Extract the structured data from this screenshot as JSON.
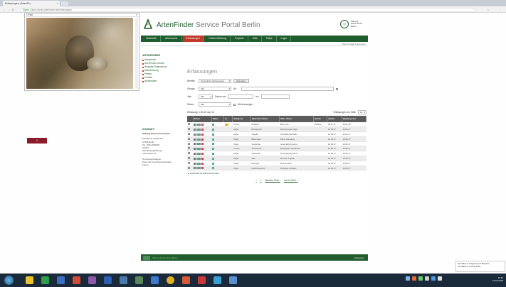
{
  "browser": {
    "tab_title": "Erfassungen | ArtenFin...",
    "tab_close": "×",
    "url_scheme": "https://",
    "url_path": "berlin.artenfinder.net/erfassungen",
    "url_prefix": "Sicher",
    "back": "←",
    "forward": "→",
    "reload": "C",
    "home": "⌂",
    "star": "☆",
    "menu": "⋮"
  },
  "popup": {
    "title": "1 Foto",
    "close": "×"
  },
  "red_button": "1",
  "site": {
    "logo_main": "ArtenFinder",
    "logo_rest": " Service Portal Berlin",
    "stiftung": "Stiftung\nNaturschutz\nBerlin",
    "nav": [
      "Startseite",
      "Artensuche",
      "Erfassungen",
      "Online-Meldung",
      "Projekte",
      "Hilfe",
      "FAQs",
      "Login"
    ],
    "nav_active_index": 2,
    "subnav": "Über Kontakt   Impressum"
  },
  "sidebar": {
    "heading": "ARTENFINDER",
    "links": [
      "Artensuche",
      "ArtenFinder werden",
      "Hinweise Datenschutz",
      "Datennutzung",
      "Presse",
      "Kontakt",
      "Nutzerdaten"
    ],
    "kontakt_heading": "KONTAKT",
    "kontakt_org": "Stiftung Naturschutz Berlin",
    "kontakt_address": "Potsdamer Straße 68\n10785 Berlin\nTel.: 030-2639400\nE-Mail:\nartenfinder@stiftung-\nnaturschutz.de",
    "kontakt_partner": "Ihr Ansprechpartner:\nTeam der Koordinierungsstelle\nFauna"
  },
  "content": {
    "heading": "Erfassungen",
    "filters": {
      "bereich_label": "Bereich",
      "bereich_value": "Persönliche Erfassungen",
      "absenden": "Absenden",
      "gruppe_label": "Gruppe",
      "gruppe_value": "Alle",
      "art_label": "Art",
      "jahr_label": "Jahr",
      "jahr_value": "Alle",
      "datum_von_label": "Datum von",
      "datum_bis_label": "bis",
      "status_label": "Status",
      "status_value": "Alle",
      "nicht_anzeigen": "Nicht anzeigen"
    },
    "summary": "Erfassung: 1 bis 10 von 10",
    "per_page_label": "Erfassungen pro Seite",
    "per_page_value": "10",
    "table_headers": [
      "",
      "Aktion",
      "Bilder",
      "B.",
      "Kategorie",
      "Deutscher Name",
      "Wiss. Name",
      "Bezirk",
      "Datum",
      "Meldung vom"
    ],
    "rows": [
      {
        "kat": "Lurche",
        "de": "Erdkröte",
        "wiss": "Bufo bufo",
        "bezirk": "Pankow",
        "datum": "05.11.17",
        "meldung": "10.01.18",
        "thumb": true
      },
      {
        "kat": "Vögel",
        "de": "Buntspecht",
        "wiss": "Dendrocopos major",
        "bezirk": "",
        "datum": "10.05.17",
        "meldung": "10.06.17",
        "thumb": false
      },
      {
        "kat": "Vögel",
        "de": "Stieglitz",
        "wiss": "Carduelis carduelis",
        "bezirk": "",
        "datum": "10.05.17",
        "meldung": "10.06.17",
        "thumb": false
      },
      {
        "kat": "Vögel",
        "de": "Blaumeise",
        "wiss": "Parus caeruleus",
        "bezirk": "",
        "datum": "10.05.17",
        "meldung": "10.06.17",
        "thumb": false
      },
      {
        "kat": "Vögel",
        "de": "Stockente",
        "wiss": "Anas platyrhynchos",
        "bezirk": "",
        "datum": "10.05.17",
        "meldung": "10.06.17",
        "thumb": false
      },
      {
        "kat": "Lurche",
        "de": "Teichfrosch",
        "wiss": "Pelophylax esculentus",
        "bezirk": "",
        "datum": "10.05.17",
        "meldung": "10.06.17",
        "thumb": false
      },
      {
        "kat": "Vögel",
        "de": "Stockente",
        "wiss": "Anas platyrhynchos",
        "bezirk": "",
        "datum": "10.05.17",
        "meldung": "10.06.17",
        "thumb": false
      },
      {
        "kat": "Vögel",
        "de": "Star",
        "wiss": "Sturnus vulgaris",
        "bezirk": "",
        "datum": "10.05.17",
        "meldung": "10.06.17",
        "thumb": false
      },
      {
        "kat": "Vögel",
        "de": "Eisvogel",
        "wiss": "Alcedo atthis",
        "bezirk": "",
        "datum": "10.05.17",
        "meldung": "10.06.17",
        "thumb": false
      },
      {
        "kat": "Vögel",
        "de": "Haubentaucher",
        "wiss": "Podiceps cristatus",
        "bezirk": "",
        "datum": "10.05.17",
        "meldung": "10.06.17",
        "thumb": false
      }
    ],
    "mark_link": "▲ MARKIERTE ERFASSUNGEN",
    "pager_prev": "‹",
    "pager_current": "1",
    "pager_next": "Nächste Seite ›",
    "pager_last": "Letzte Seite »"
  },
  "footer": {
    "left": "Stiftung Naturschutz Berlin",
    "right": "Impressum"
  },
  "notification": "Sie haben 0 zeitgesteuerte Berichte.\nSie haben 0 neue E-Mails.",
  "clock": "11:34\n16.02.2018"
}
